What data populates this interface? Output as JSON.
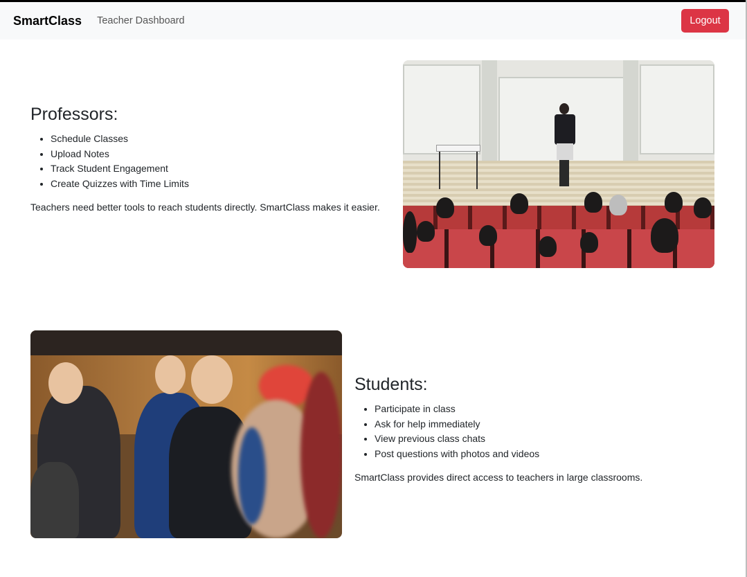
{
  "navbar": {
    "brand": "SmartClass",
    "link": "Teacher Dashboard",
    "logout_label": "Logout"
  },
  "professors": {
    "heading": "Professors:",
    "features": [
      "Schedule Classes",
      "Upload Notes",
      "Track Student Engagement",
      "Create Quizzes with Time Limits"
    ],
    "description": "Teachers need better tools to reach students directly. SmartClass makes it easier."
  },
  "students": {
    "heading": "Students:",
    "features": [
      "Participate in class",
      "Ask for help immediately",
      "View previous class chats",
      "Post questions with photos and videos"
    ],
    "description": "SmartClass provides direct access to teachers in large classrooms."
  },
  "colors": {
    "navbar_bg": "#f8f9fa",
    "logout_bg": "#dc3545",
    "text": "#212529"
  }
}
